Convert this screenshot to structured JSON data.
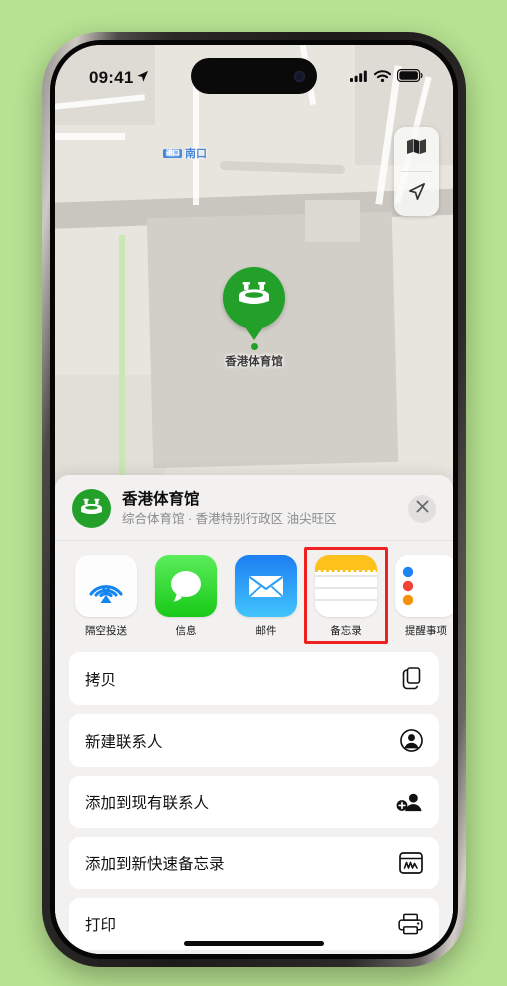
{
  "status_bar": {
    "time": "09:41",
    "location_arrow": "location-arrow-icon",
    "cellular": "cellular-signal-icon",
    "wifi": "wifi-icon",
    "battery": "battery-icon"
  },
  "map": {
    "label_nankou_badge": "进口",
    "label_nankou": "南口",
    "pin_label": "香港体育馆",
    "controls": {
      "layers": "map-layers-icon",
      "locate": "locate-me-icon"
    }
  },
  "share_sheet": {
    "title": "香港体育馆",
    "subtitle": "综合体育馆 · 香港特别行政区 油尖旺区",
    "close_label": "✕",
    "apps": [
      {
        "label": "隔空投送",
        "icon": "airdrop-icon",
        "highlighted": false
      },
      {
        "label": "信息",
        "icon": "messages-icon",
        "highlighted": false
      },
      {
        "label": "邮件",
        "icon": "mail-icon",
        "highlighted": false
      },
      {
        "label": "备忘录",
        "icon": "notes-icon",
        "highlighted": true
      },
      {
        "label": "提醒事项",
        "icon": "reminders-icon",
        "highlighted": false
      }
    ],
    "actions": [
      {
        "label": "拷贝",
        "icon": "copy-icon"
      },
      {
        "label": "新建联系人",
        "icon": "new-contact-icon"
      },
      {
        "label": "添加到现有联系人",
        "icon": "add-to-contact-icon"
      },
      {
        "label": "添加到新快速备忘录",
        "icon": "quick-note-icon"
      },
      {
        "label": "打印",
        "icon": "printer-icon"
      }
    ]
  },
  "colors": {
    "background": "#b7e291",
    "accent_green": "#22a02a",
    "highlight_red": "#f02020",
    "sheet_bg": "#f2f1f0"
  }
}
